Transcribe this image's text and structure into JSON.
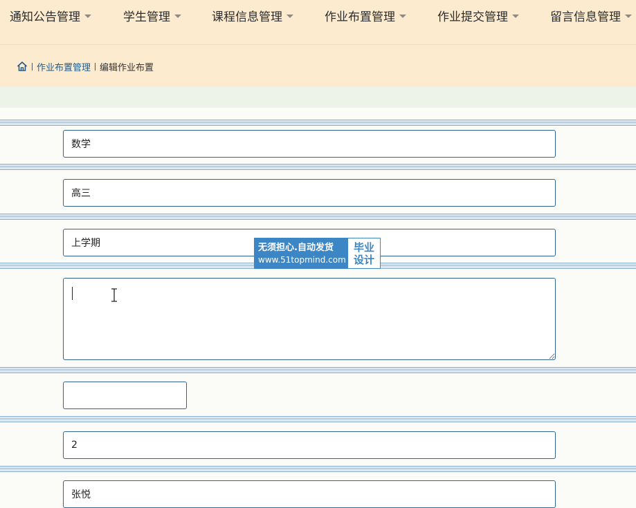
{
  "nav": {
    "items": [
      {
        "label": "通知公告管理"
      },
      {
        "label": "学生管理"
      },
      {
        "label": "课程信息管理"
      },
      {
        "label": "作业布置管理"
      },
      {
        "label": "作业提交管理"
      },
      {
        "label": "留言信息管理"
      }
    ]
  },
  "breadcrumb": {
    "section": "作业布置管理",
    "current": "编辑作业布置"
  },
  "form": {
    "course": "数学",
    "grade": "高三",
    "semester": "上学期",
    "content": "",
    "short_field": "",
    "number": "2",
    "teacher": "张悦"
  },
  "watermark": {
    "slogan": "无须担心.自动发货",
    "url": "www.51topmind.com",
    "tag_line1": "毕业",
    "tag_line2": "设计"
  },
  "colors": {
    "nav_bg": "#fdebd0",
    "field_border": "#2f6593",
    "link": "#1f5b8c",
    "watermark_blue": "#3d86c6"
  }
}
